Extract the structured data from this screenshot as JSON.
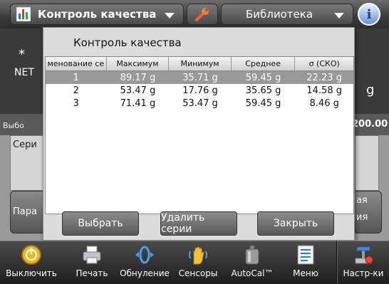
{
  "header": {
    "app_name": "Контроль качества",
    "library_label": "Библиотека"
  },
  "background": {
    "star": "*",
    "net": "NET",
    "unit": "g",
    "selection_label": "Выбо",
    "value_fragment": "200.00",
    "series_label": "Сери",
    "params_label": "Пара",
    "right_fragment_1": "ая",
    "right_fragment_2": "ия"
  },
  "dialog": {
    "title": "Контроль качества",
    "columns": [
      "менование се",
      "Максимум",
      "Минимум",
      "Среднее",
      "σ (СКО)"
    ],
    "rows": [
      {
        "name": "1",
        "max": "89.17 g",
        "min": "35.71 g",
        "avg": "59.45 g",
        "sd": "22.23 g"
      },
      {
        "name": "2",
        "max": "53.47 g",
        "min": "17.76 g",
        "avg": "35.65 g",
        "sd": "14.58 g"
      },
      {
        "name": "3",
        "max": "71.41 g",
        "min": "53.47 g",
        "avg": "59.45 g",
        "sd": "8.46 g"
      }
    ],
    "selected_row": 1,
    "buttons": {
      "select": "Выбрать",
      "delete": "Удалить серии",
      "close": "Закрыть"
    }
  },
  "toolbar": {
    "power": "Выключить",
    "print": "Печать",
    "zero": "Обнуление",
    "sensors": "Сенсоры",
    "autocal": "AutoCal™",
    "menu": "Меню",
    "settings": "Настр-ки"
  },
  "colors": {
    "selected_row": "#999999",
    "accent_info": "#1d3f8a"
  }
}
